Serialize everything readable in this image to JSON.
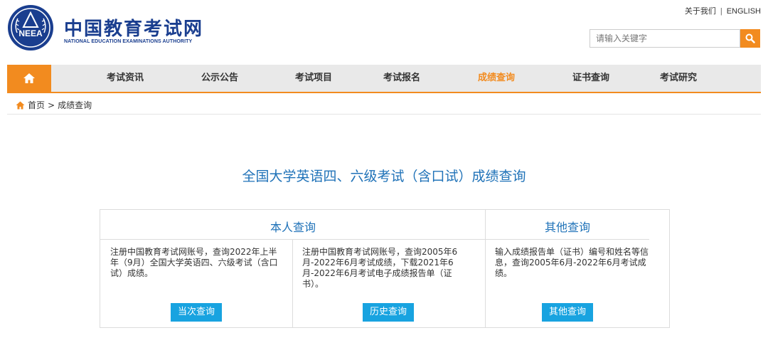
{
  "header": {
    "logo_text": "NEEA",
    "brand_cn": "中国教育考试网",
    "brand_en": "NATIONAL EDUCATION EXAMINATIONS AUTHORITY",
    "top_links": {
      "about": "关于我们",
      "separator": "|",
      "english": "ENGLISH"
    },
    "search": {
      "placeholder": "请输入关键字",
      "icon": "search-icon"
    }
  },
  "nav": {
    "home_icon": "home-icon",
    "items": [
      {
        "label": "考试资讯"
      },
      {
        "label": "公示公告"
      },
      {
        "label": "考试项目"
      },
      {
        "label": "考试报名"
      },
      {
        "label": "成绩查询",
        "active": true
      },
      {
        "label": "证书查询"
      },
      {
        "label": "考试研究"
      }
    ]
  },
  "breadcrumb": {
    "home": "首页",
    "separator": ">",
    "current": "成绩查询"
  },
  "page": {
    "title": "全国大学英语四、六级考试（含口试）成绩查询"
  },
  "panel": {
    "self_section": "本人查询",
    "other_section": "其他查询",
    "cells": [
      {
        "text": "注册中国教育考试网账号，查询2022年上半年（9月）全国大学英语四、六级考试（含口试）成绩。",
        "button": "当次查询"
      },
      {
        "text": "注册中国教育考试网账号，查询2005年6月-2022年6月考试成绩，下载2021年6月-2022年6月考试电子成绩报告单（证书）。",
        "button": "历史查询"
      },
      {
        "text": "输入成绩报告单（证书）编号和姓名等信息，查询2005年6月-2022年6月考试成绩。",
        "button": "其他查询"
      }
    ]
  },
  "colors": {
    "brand": "#1a3e8f",
    "accent": "#f28b1f",
    "title": "#1f72b8",
    "button": "#18a3e0"
  }
}
